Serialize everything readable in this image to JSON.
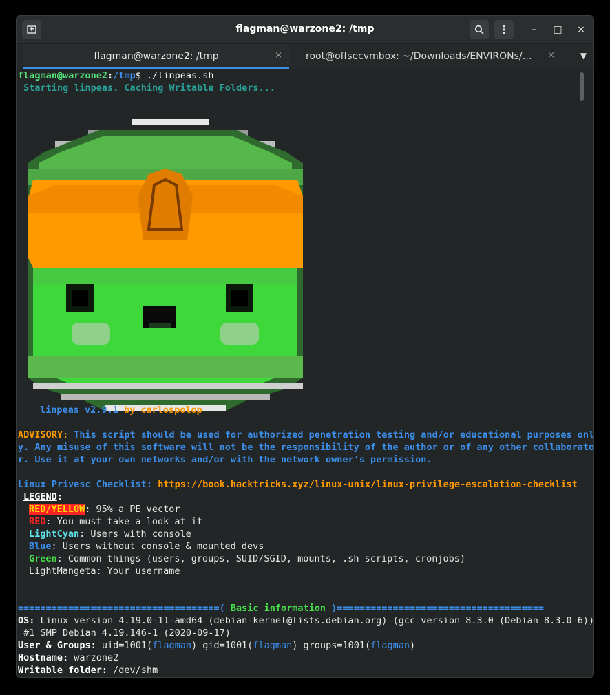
{
  "titlebar": {
    "title": "flagman@warzone2: /tmp",
    "new_tab_icon": "new-tab-icon",
    "search_icon": "search-icon",
    "menu_icon": "kebab-menu-icon",
    "minimize": "–",
    "maximize": "□",
    "close": "×"
  },
  "tabs": [
    {
      "label": "flagman@warzone2: /tmp",
      "close": "×"
    },
    {
      "label": "root@offsecvmbox: ~/Downloads/ENVIRONs/LO…",
      "close": "×"
    }
  ],
  "tab_dropdown": "▼",
  "terminal": {
    "prompt_user": "flagman@warzone2",
    "prompt_sep": ":",
    "prompt_path": "/tmp",
    "prompt_cmd": "$ ./linpeas.sh",
    "starting": " Starting linpeas. Caching Writable Folders...",
    "version": "linpeas v2.9.1",
    "by": "by",
    "author": "carlospolop",
    "advisory_label": "ADVISORY:",
    "advisory_1": " This script should be used for authorized penetration testing and/or educational purposes onl",
    "advisory_2": "y. Any misuse of this software will not be the responsibility of the author or of any other collaborato",
    "advisory_3": "r. Use it at your own networks and/or with the network owner's permission.",
    "checklist_label": "Linux Privesc Checklist:",
    "checklist_url": "https://book.hacktricks.xyz/linux-unix/linux-privilege-escalation-checklist",
    "legend_title": "LEGEND",
    "legend_colon": ":",
    "legend": [
      {
        "key": "RED/YELLOW",
        "text": ": 95% a PE vector"
      },
      {
        "key": "RED",
        "text": ": You must take a look at it"
      },
      {
        "key": "LightCyan",
        "text": ": Users with console"
      },
      {
        "key": "Blue",
        "text": ": Users without console & mounted devs"
      },
      {
        "key": "Green",
        "text": ": Common things (users, groups, SUID/SGID, mounts, .sh scripts, cronjobs)"
      },
      {
        "key": "LightMangeta",
        "text": ": Your username"
      }
    ],
    "section_left": "====================================(",
    "section_title": " Basic information ",
    "section_right": ")=====================================",
    "os_label": "OS:",
    "os_value": " Linux version 4.19.0-11-amd64 (debian-kernel@lists.debian.org) (gcc version 8.3.0 (Debian 8.3.0-6))",
    "os_value_2": " #1 SMP Debian 4.19.146-1 (2020-09-17)",
    "ug_label": "User & Groups:",
    "ug_1": " uid=1001(",
    "ug_user": "flagman",
    "ug_2": ") gid=1001(",
    "ug_3": ") groups=1001(",
    "ug_4": ")",
    "host_label": "Hostname:",
    "host_value": " warzone2",
    "wf_label": "Writable folder:",
    "wf_value": " /dev/shm"
  },
  "colors": {
    "background": "#232627",
    "green": "#56e37a",
    "blue": "#3b8eea",
    "orange": "#ff9900",
    "red": "#ff2222",
    "yellow": "#ffd800",
    "teal": "#2aa198"
  }
}
